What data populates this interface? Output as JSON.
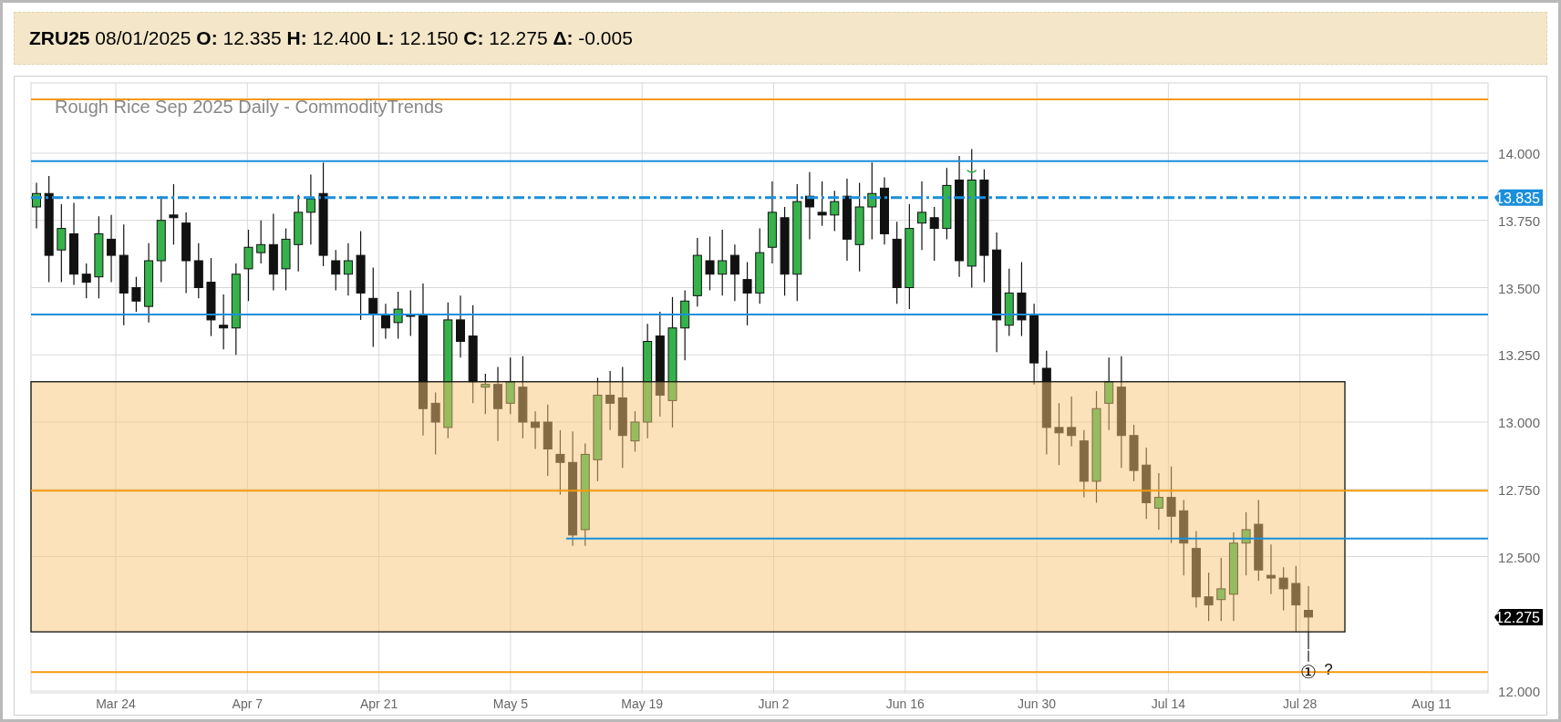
{
  "quote_summary": "**ZRU25** 08/01/2025 **O:** 12.335 **H:** 12.400 **L:** 12.150 **C:** 12.275 **Δ:** -0.005",
  "chart": {
    "title": "Rough Rice Sep 2025 Daily - CommodityTrends",
    "y_axis_labels": [
      "14.000",
      "13.750",
      "13.500",
      "13.250",
      "13.000",
      "12.750",
      "12.500",
      "12.000"
    ],
    "x_axis_labels": [
      "Mar 24",
      "Apr 7",
      "Apr 21",
      "May 5",
      "May 19",
      "Jun 2",
      "Jun 16",
      "Jun 30",
      "Jul 14",
      "Jul 28",
      "Aug 11"
    ],
    "price_tags": [
      {
        "text": "13.835",
        "color": "#1a8fdb"
      },
      {
        "text": "12.275",
        "color": "#000000"
      }
    ],
    "marker": {
      "symbol": "①",
      "note": "?"
    }
  }
}
